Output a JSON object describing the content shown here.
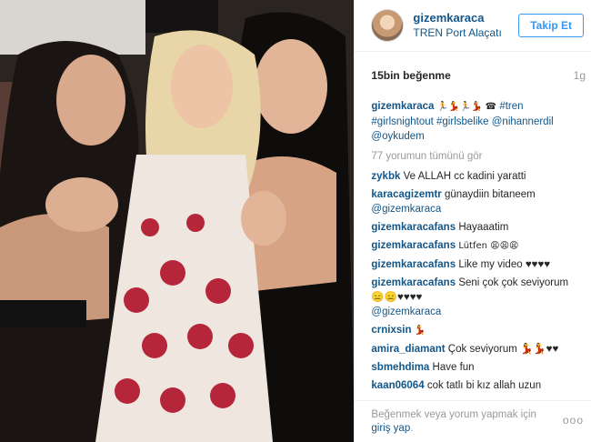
{
  "header": {
    "username": "gizemkaraca",
    "location": "TREN Port Alaçatı",
    "follow_label": "Takip Et"
  },
  "stats": {
    "likes": "15bin beğenme",
    "age": "1g"
  },
  "caption": {
    "user": "gizemkaraca",
    "emojis_1": "🏃💃🏃💃 ☎",
    "tag_tren": "#tren",
    "tag_girlsnightout": "#girlsnightout",
    "tag_girlsbelike": "#girlsbelike",
    "mention_nihannerdil": "@nihannerdil",
    "mention_oykudem": "@oykudem"
  },
  "load_more": "77 yorumun tümünü gör",
  "comments": [
    {
      "user": "zykbk",
      "text": "Ve ALLAH cc kadini yaratti"
    },
    {
      "user": "karacagizemtr",
      "text": "günaydiin bitaneem",
      "mention": "@gizemkaraca"
    },
    {
      "user": "gizemkaracafans",
      "text": "Hayaaatim"
    },
    {
      "user": "gizemkaracafans",
      "text": "Lütfen 😩😩😩"
    },
    {
      "user": "gizemkaracafans",
      "text": "Like my video ♥♥♥♥"
    },
    {
      "user": "gizemkaracafans",
      "text": "Seni çok çok seviyorum 😑😑♥♥♥♥",
      "mention": "@gizemkaraca"
    },
    {
      "user": "crnixsin",
      "text": "💃"
    },
    {
      "user": "amira_diamant",
      "text": "Çok seviyorum 💃💃♥♥"
    },
    {
      "user": "sbmehdima",
      "text": "Have fun"
    },
    {
      "user": "kaan06064",
      "text": "cok tatlı bi kız allah uzun"
    }
  ],
  "footer": {
    "prompt": "Beğenmek veya yorum yapmak için",
    "login": "giriş yap",
    "period": ".",
    "more_options": "ooo"
  },
  "colors": {
    "link_blue": "#125688",
    "follow_blue": "#3897f0",
    "muted": "#999999"
  }
}
